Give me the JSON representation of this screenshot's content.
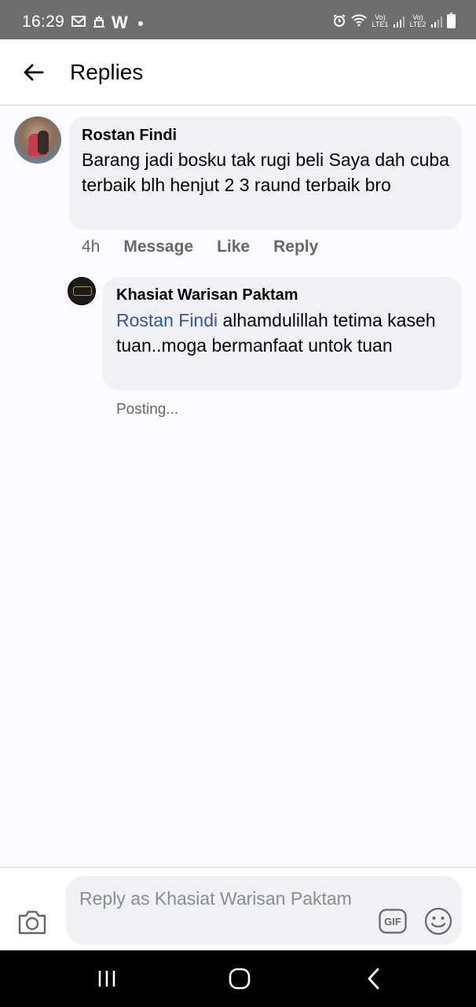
{
  "status_bar": {
    "time": "16:29",
    "left_icons": [
      "mail-icon",
      "notification-icon",
      "w-app-icon"
    ],
    "w_label": "W",
    "right_sim1": "Vo) LTE1",
    "right_sim2": "Vo) LTE2"
  },
  "header": {
    "title": "Replies"
  },
  "comment": {
    "author": "Rostan Findi",
    "text": "Barang jadi bosku tak rugi beli Saya dah cuba terbaik blh henjut 2 3 raund terbaik bro",
    "time": "4h",
    "actions": {
      "message": "Message",
      "like": "Like",
      "reply": "Reply"
    }
  },
  "reply": {
    "author": "Khasiat Warisan Paktam",
    "mention": "Rostan Findi",
    "text": " alhamdulillah tetima kaseh tuan..moga bermanfaat untok tuan",
    "status": "Posting..."
  },
  "composer": {
    "placeholder": "Reply as Khasiat Warisan Paktam",
    "gif_label": "GIF"
  },
  "colors": {
    "mention": "#385898",
    "bubble": "#f0f0f5",
    "secondary_text": "#65676b",
    "status_bar": "#6e6e6e"
  }
}
